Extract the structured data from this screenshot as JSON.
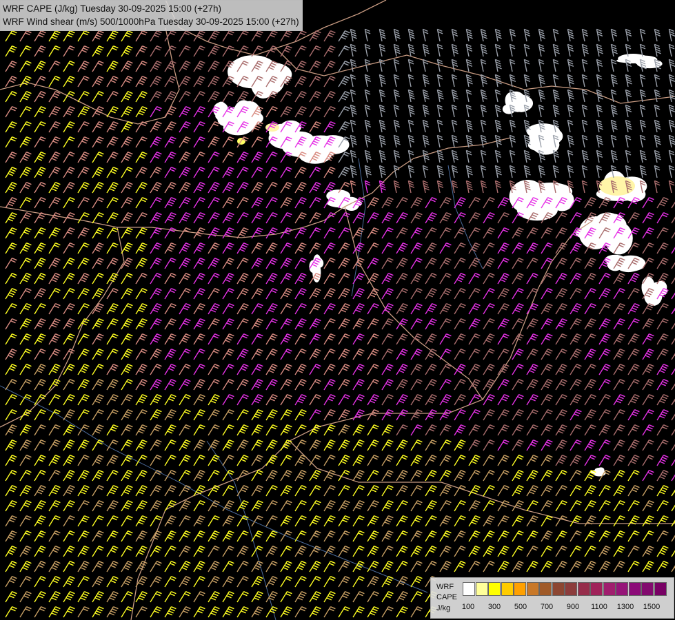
{
  "title": {
    "line1": "WRF CAPE (J/kg) Tuesday 30-09-2025 15:00 (+27h)",
    "line2": "WRF Wind shear (m/s) 500/1000hPa Tuesday 30-09-2025 15:00 (+27h)"
  },
  "legend": {
    "model": "WRF",
    "variable": "CAPE",
    "unit": "J/kg",
    "tick_labels": [
      "100",
      "300",
      "500",
      "700",
      "900",
      "1100",
      "1300",
      "1500"
    ],
    "colors": [
      "#ffffff",
      "#ffff99",
      "#ffff00",
      "#ffcc00",
      "#ffa000",
      "#c87828",
      "#a05a28",
      "#8c4632",
      "#8c3c3c",
      "#962d4b",
      "#a0235a",
      "#a01e6e",
      "#961478",
      "#8c0a78",
      "#820a6e",
      "#780064"
    ]
  },
  "colors": {
    "background": "#000000",
    "barb_yellow": "#ffff22",
    "barb_tan": "#c8a064",
    "barb_salmon": "#d98c82",
    "barb_rose": "#aa6e6e",
    "barb_magenta": "#e632e6",
    "barb_grey": "#9aa0aa",
    "border": "#c89b82",
    "river": "#4a6a9a",
    "cape_patch": "#ffffff"
  }
}
